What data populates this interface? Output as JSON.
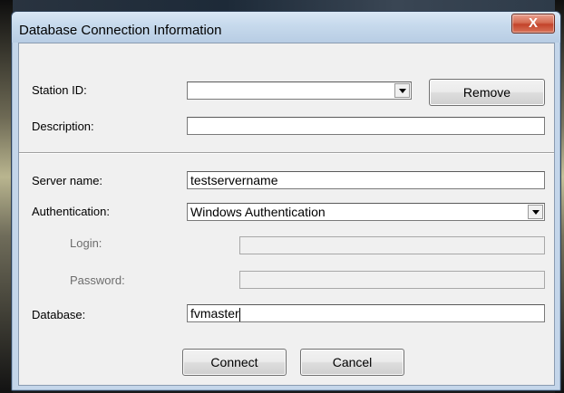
{
  "dialog": {
    "title": "Database Connection Information",
    "close_glyph": "X"
  },
  "station": {
    "label": "Station ID:",
    "value": "",
    "remove_label": "Remove"
  },
  "description": {
    "label": "Description:",
    "value": ""
  },
  "server": {
    "label": "Server name:",
    "value": "testservername"
  },
  "authentication": {
    "label": "Authentication:",
    "value": "Windows Authentication"
  },
  "login": {
    "label": "Login:",
    "value": ""
  },
  "password": {
    "label": "Password:",
    "value": ""
  },
  "database": {
    "label": "Database:",
    "value": "fvmaster"
  },
  "actions": {
    "connect_label": "Connect",
    "cancel_label": "Cancel"
  },
  "colors": {
    "frame": "#c4d6ea",
    "client": "#f0f0f0",
    "close_button": "#c3432a"
  }
}
